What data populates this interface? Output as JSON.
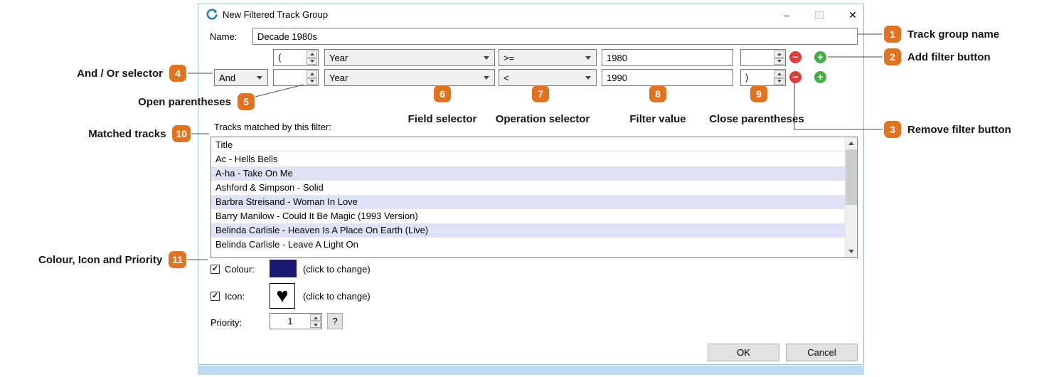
{
  "colors": {
    "annotation_badge": "#E2721E",
    "remove_button": "#E23B3B",
    "add_button": "#44AD44",
    "colour_swatch": "#191970",
    "selected_row": "#E2E2F6"
  },
  "window": {
    "title": "New Filtered Track Group",
    "minimize_glyph": "–",
    "close_glyph": "✕"
  },
  "name_field": {
    "label": "Name:",
    "value": "Decade 1980s"
  },
  "filter_rows": [
    {
      "and_or": "",
      "open_paren": "(",
      "field": "Year",
      "operation": ">=",
      "value": "1980",
      "close_paren": ""
    },
    {
      "and_or": "And",
      "open_paren": "",
      "field": "Year",
      "operation": "<",
      "value": "1990",
      "close_paren": ")"
    }
  ],
  "filter_icons": {
    "remove_glyph": "−",
    "add_glyph": "+"
  },
  "tracks": {
    "label": "Tracks matched by this filter:",
    "column_header": "Title",
    "items": [
      "Ac - Hells Bells",
      "A-ha - Take On Me",
      "Ashford & Simpson - Solid",
      "Barbra Streisand - Woman In Love",
      "Barry Manilow - Could It Be Magic (1993 Version)",
      "Belinda Carlisle - Heaven Is A Place On Earth (Live)",
      "Belinda Carlisle - Leave A Light On"
    ]
  },
  "appearance": {
    "colour_label": "Colour:",
    "colour_check": "✓",
    "icon_label": "Icon:",
    "icon_check": "✓",
    "icon_glyph": "♥",
    "click_to_change": "(click to change)",
    "priority_label": "Priority:",
    "priority_value": "1",
    "help_label": "?"
  },
  "dialog_buttons": {
    "ok": "OK",
    "cancel": "Cancel"
  },
  "annotations": [
    {
      "num": "1",
      "label": "Track group name"
    },
    {
      "num": "2",
      "label": "Add filter button"
    },
    {
      "num": "3",
      "label": "Remove filter button"
    },
    {
      "num": "4",
      "label": "And / Or selector"
    },
    {
      "num": "5",
      "label": "Open parentheses"
    },
    {
      "num": "6",
      "label": "Field selector"
    },
    {
      "num": "7",
      "label": "Operation selector"
    },
    {
      "num": "8",
      "label": "Filter value"
    },
    {
      "num": "9",
      "label": "Close parentheses"
    },
    {
      "num": "10",
      "label": "Matched tracks"
    },
    {
      "num": "11",
      "label": "Colour, Icon and Priority"
    }
  ]
}
